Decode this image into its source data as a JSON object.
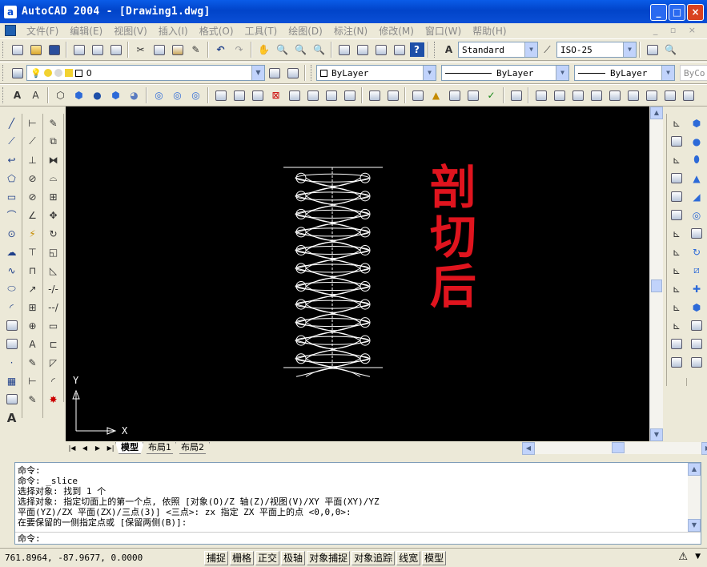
{
  "window": {
    "app_icon": "a",
    "title": "AutoCAD 2004 - [Drawing1.dwg]",
    "minimize": "_",
    "maximize": "□",
    "close": "×"
  },
  "menu": {
    "items": [
      "文件(F)",
      "编辑(E)",
      "视图(V)",
      "插入(I)",
      "格式(O)",
      "工具(T)",
      "绘图(D)",
      "标注(N)",
      "修改(M)",
      "窗口(W)",
      "帮助(H)"
    ],
    "mdi_controls": "_ ▫ ×"
  },
  "toolbar_styles": {
    "text_style": "Standard",
    "dim_style": "ISO-25"
  },
  "toolbar_layers": {
    "layer": "0",
    "color": "ByLayer",
    "linetype": "ByLayer",
    "lineweight": "ByLayer",
    "plotstyle": "ByCo"
  },
  "drawing": {
    "annotation": "剖切后",
    "ucs_x": "X",
    "ucs_y": "Y"
  },
  "tabs": {
    "items": [
      "模型",
      "布局1",
      "布局2"
    ],
    "active": "模型"
  },
  "command": {
    "history": [
      "命令:",
      "命令: _slice",
      "选择对象: 找到 1 个",
      "选择对象: 指定切面上的第一个点, 依照 [对象(O)/Z 轴(Z)/视图(V)/XY 平面(XY)/YZ",
      "平面(YZ)/ZX 平面(ZX)/三点(3)] <三点>: zx 指定 ZX 平面上的点 <0,0,0>:",
      "在要保留的一侧指定点或 [保留两侧(B)]:"
    ],
    "prompt": "命令:"
  },
  "status": {
    "coordinates": "761.8964, -87.9677, 0.0000",
    "toggles": [
      "捕捉",
      "栅格",
      "正交",
      "极轴",
      "对象捕捉",
      "对象追踪",
      "线宽",
      "模型"
    ]
  },
  "colors": {
    "titlebar": "#0a4fd6",
    "canvas_bg": "#000000",
    "annotation": "#e0141e",
    "model": "#ffffff"
  }
}
